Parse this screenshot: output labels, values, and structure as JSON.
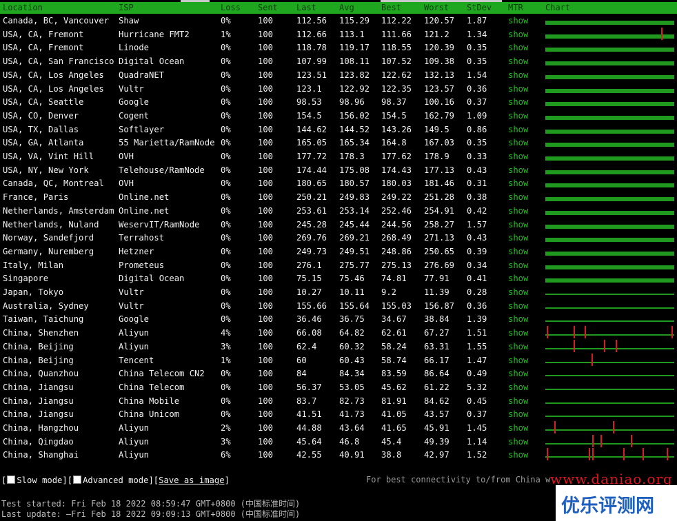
{
  "table": {
    "columns": [
      "Location",
      "ISP",
      "Loss",
      "Sent",
      "Last",
      "Avg",
      "Best",
      "Worst",
      "StDev",
      "MTR",
      "Chart"
    ],
    "rows": [
      {
        "location": "Canada, BC, Vancouver",
        "isp": "Shaw",
        "loss": "0%",
        "sent": "100",
        "last": "112.56",
        "avg": "115.29",
        "best": "112.22",
        "worst": "120.57",
        "stdev": "1.87",
        "mtr": "show"
      },
      {
        "location": "USA, CA, Fremont",
        "isp": "Hurricane FMT2",
        "loss": "1%",
        "sent": "100",
        "last": "112.66",
        "avg": "113.1",
        "best": "111.66",
        "worst": "121.2",
        "stdev": "1.34",
        "mtr": "show"
      },
      {
        "location": "USA, CA, Fremont",
        "isp": "Linode",
        "loss": "0%",
        "sent": "100",
        "last": "118.78",
        "avg": "119.17",
        "best": "118.55",
        "worst": "120.39",
        "stdev": "0.35",
        "mtr": "show"
      },
      {
        "location": "USA, CA, San Francisco",
        "isp": "Digital Ocean",
        "loss": "0%",
        "sent": "100",
        "last": "107.99",
        "avg": "108.11",
        "best": "107.52",
        "worst": "109.38",
        "stdev": "0.35",
        "mtr": "show"
      },
      {
        "location": "USA, CA, Los Angeles",
        "isp": "QuadraNET",
        "loss": "0%",
        "sent": "100",
        "last": "123.51",
        "avg": "123.82",
        "best": "122.62",
        "worst": "132.13",
        "stdev": "1.54",
        "mtr": "show"
      },
      {
        "location": "USA, CA, Los Angeles",
        "isp": "Vultr",
        "loss": "0%",
        "sent": "100",
        "last": "123.1",
        "avg": "122.92",
        "best": "122.35",
        "worst": "123.57",
        "stdev": "0.36",
        "mtr": "show"
      },
      {
        "location": "USA, CA, Seattle",
        "isp": "Google",
        "loss": "0%",
        "sent": "100",
        "last": "98.53",
        "avg": "98.96",
        "best": "98.37",
        "worst": "100.16",
        "stdev": "0.37",
        "mtr": "show"
      },
      {
        "location": "USA, CO, Denver",
        "isp": "Cogent",
        "loss": "0%",
        "sent": "100",
        "last": "154.5",
        "avg": "156.02",
        "best": "154.5",
        "worst": "162.79",
        "stdev": "1.09",
        "mtr": "show"
      },
      {
        "location": "USA, TX, Dallas",
        "isp": "Softlayer",
        "loss": "0%",
        "sent": "100",
        "last": "144.62",
        "avg": "144.52",
        "best": "143.26",
        "worst": "149.5",
        "stdev": "0.86",
        "mtr": "show"
      },
      {
        "location": "USA, GA, Atlanta",
        "isp": "55 Marietta/RamNode",
        "loss": "0%",
        "sent": "100",
        "last": "165.05",
        "avg": "165.34",
        "best": "164.8",
        "worst": "167.03",
        "stdev": "0.35",
        "mtr": "show"
      },
      {
        "location": "USA, VA, Vint Hill",
        "isp": "OVH",
        "loss": "0%",
        "sent": "100",
        "last": "177.72",
        "avg": "178.3",
        "best": "177.62",
        "worst": "178.9",
        "stdev": "0.33",
        "mtr": "show"
      },
      {
        "location": "USA, NY, New York",
        "isp": "Telehouse/RamNode",
        "loss": "0%",
        "sent": "100",
        "last": "174.44",
        "avg": "175.08",
        "best": "174.43",
        "worst": "177.13",
        "stdev": "0.43",
        "mtr": "show"
      },
      {
        "location": "Canada, QC, Montreal",
        "isp": "OVH",
        "loss": "0%",
        "sent": "100",
        "last": "180.65",
        "avg": "180.57",
        "best": "180.03",
        "worst": "181.46",
        "stdev": "0.31",
        "mtr": "show"
      },
      {
        "location": "France, Paris",
        "isp": "Online.net",
        "loss": "0%",
        "sent": "100",
        "last": "250.21",
        "avg": "249.83",
        "best": "249.22",
        "worst": "251.28",
        "stdev": "0.38",
        "mtr": "show"
      },
      {
        "location": "Netherlands, Amsterdam",
        "isp": "Online.net",
        "loss": "0%",
        "sent": "100",
        "last": "253.61",
        "avg": "253.14",
        "best": "252.46",
        "worst": "254.91",
        "stdev": "0.42",
        "mtr": "show"
      },
      {
        "location": "Netherlands, Nuland",
        "isp": "WeservIT/RamNode",
        "loss": "0%",
        "sent": "100",
        "last": "245.28",
        "avg": "245.44",
        "best": "244.56",
        "worst": "258.27",
        "stdev": "1.57",
        "mtr": "show"
      },
      {
        "location": "Norway, Sandefjord",
        "isp": "Terrahost",
        "loss": "0%",
        "sent": "100",
        "last": "269.76",
        "avg": "269.21",
        "best": "268.49",
        "worst": "271.13",
        "stdev": "0.43",
        "mtr": "show"
      },
      {
        "location": "Germany, Nuremberg",
        "isp": "Hetzner",
        "loss": "0%",
        "sent": "100",
        "last": "249.73",
        "avg": "249.51",
        "best": "248.86",
        "worst": "250.65",
        "stdev": "0.39",
        "mtr": "show"
      },
      {
        "location": "Italy, Milan",
        "isp": "Prometeus",
        "loss": "0%",
        "sent": "100",
        "last": "276.1",
        "avg": "275.77",
        "best": "275.13",
        "worst": "276.69",
        "stdev": "0.34",
        "mtr": "show"
      },
      {
        "location": "Singapore",
        "isp": "Digital Ocean",
        "loss": "0%",
        "sent": "100",
        "last": "75.15",
        "avg": "75.46",
        "best": "74.81",
        "worst": "77.91",
        "stdev": "0.41",
        "mtr": "show"
      },
      {
        "location": "Japan, Tokyo",
        "isp": "Vultr",
        "loss": "0%",
        "sent": "100",
        "last": "10.27",
        "avg": "10.11",
        "best": "9.2",
        "worst": "11.39",
        "stdev": "0.28",
        "mtr": "show"
      },
      {
        "location": "Australia, Sydney",
        "isp": "Vultr",
        "loss": "0%",
        "sent": "100",
        "last": "155.66",
        "avg": "155.64",
        "best": "155.03",
        "worst": "156.87",
        "stdev": "0.36",
        "mtr": "show"
      },
      {
        "location": "Taiwan, Taichung",
        "isp": "Google",
        "loss": "0%",
        "sent": "100",
        "last": "36.46",
        "avg": "36.75",
        "best": "34.67",
        "worst": "38.84",
        "stdev": "1.39",
        "mtr": "show"
      },
      {
        "location": "China, Shenzhen",
        "isp": "Aliyun",
        "loss": "4%",
        "sent": "100",
        "last": "66.08",
        "avg": "64.82",
        "best": "62.61",
        "worst": "67.27",
        "stdev": "1.51",
        "mtr": "show"
      },
      {
        "location": "China, Beijing",
        "isp": "Aliyun",
        "loss": "3%",
        "sent": "100",
        "last": "62.4",
        "avg": "60.32",
        "best": "58.24",
        "worst": "63.31",
        "stdev": "1.55",
        "mtr": "show"
      },
      {
        "location": "China, Beijing",
        "isp": "Tencent",
        "loss": "1%",
        "sent": "100",
        "last": "60",
        "avg": "60.43",
        "best": "58.74",
        "worst": "66.17",
        "stdev": "1.47",
        "mtr": "show"
      },
      {
        "location": "China, Quanzhou",
        "isp": "China Telecom CN2",
        "loss": "0%",
        "sent": "100",
        "last": "84",
        "avg": "84.34",
        "best": "83.59",
        "worst": "86.64",
        "stdev": "0.49",
        "mtr": "show"
      },
      {
        "location": "China, Jiangsu",
        "isp": "China Telecom",
        "loss": "0%",
        "sent": "100",
        "last": "56.37",
        "avg": "53.05",
        "best": "45.62",
        "worst": "61.22",
        "stdev": "5.32",
        "mtr": "show"
      },
      {
        "location": "China, Jiangsu",
        "isp": "China Mobile",
        "loss": "0%",
        "sent": "100",
        "last": "83.7",
        "avg": "82.73",
        "best": "81.91",
        "worst": "84.62",
        "stdev": "0.45",
        "mtr": "show"
      },
      {
        "location": "China, Jiangsu",
        "isp": "China Unicom",
        "loss": "0%",
        "sent": "100",
        "last": "41.51",
        "avg": "41.73",
        "best": "41.05",
        "worst": "43.57",
        "stdev": "0.37",
        "mtr": "show"
      },
      {
        "location": "China, Hangzhou",
        "isp": "Aliyun",
        "loss": "2%",
        "sent": "100",
        "last": "44.88",
        "avg": "43.64",
        "best": "41.65",
        "worst": "45.91",
        "stdev": "1.45",
        "mtr": "show"
      },
      {
        "location": "China, Qingdao",
        "isp": "Aliyun",
        "loss": "3%",
        "sent": "100",
        "last": "45.64",
        "avg": "46.8",
        "best": "45.4",
        "worst": "49.39",
        "stdev": "1.14",
        "mtr": "show"
      },
      {
        "location": "China, Shanghai",
        "isp": "Aliyun",
        "loss": "6%",
        "sent": "100",
        "last": "42.55",
        "avg": "40.91",
        "best": "38.8",
        "worst": "42.97",
        "stdev": "1.52",
        "mtr": "show"
      }
    ]
  },
  "controls": {
    "open_bracket": "[",
    "slow_mode_label": "Slow mode",
    "sep": "][",
    "advanced_mode_label": "Advanced mode",
    "sep2": "][",
    "save_label": "Save as image",
    "close_bracket": "]"
  },
  "note": "For best connectivity to/from China w",
  "status": {
    "test_started": "Test started: Fri Feb 18 2022 08:59:47 GMT+0800 (中国标准时间)",
    "last_update": "Last update: —Fri Feb 18 2022 09:09:13 GMT+0800 (中国标准时间)"
  },
  "watermark": {
    "url": "www.daniao.org",
    "text": "优乐评测网"
  },
  "colors": {
    "header_bg": "#1fa81f",
    "bar": "#1f9a1f",
    "spike": "#d42020",
    "mtr_link": "#20c020"
  },
  "chart_data": {
    "type": "bar",
    "xlabel": "",
    "ylabel": "",
    "series": [
      {
        "spikes": []
      },
      {
        "spikes": [
          0.91
        ]
      },
      {
        "spikes": []
      },
      {
        "spikes": []
      },
      {
        "spikes": []
      },
      {
        "spikes": []
      },
      {
        "spikes": []
      },
      {
        "spikes": []
      },
      {
        "spikes": []
      },
      {
        "spikes": []
      },
      {
        "spikes": []
      },
      {
        "spikes": []
      },
      {
        "spikes": []
      },
      {
        "spikes": []
      },
      {
        "spikes": []
      },
      {
        "spikes": []
      },
      {
        "spikes": []
      },
      {
        "spikes": []
      },
      {
        "spikes": []
      },
      {
        "spikes": []
      },
      {
        "spikes": [],
        "thin": true
      },
      {
        "spikes": [],
        "thin": true
      },
      {
        "spikes": [],
        "thin": true
      },
      {
        "spikes": [
          0.01,
          0.22,
          0.31,
          0.99
        ],
        "thin": true
      },
      {
        "spikes": [
          0.22,
          0.46,
          0.55
        ],
        "thin": true
      },
      {
        "spikes": [
          0.36
        ],
        "thin": true
      },
      {
        "spikes": [],
        "thin": true
      },
      {
        "spikes": [],
        "thin": true
      },
      {
        "spikes": [],
        "thin": true
      },
      {
        "spikes": [],
        "thin": true
      },
      {
        "spikes": [
          0.07,
          0.53
        ],
        "thin": true
      },
      {
        "spikes": [
          0.37,
          0.43,
          0.67
        ],
        "thin": true
      },
      {
        "spikes": [
          0.01,
          0.34,
          0.37,
          0.61,
          0.76,
          0.95
        ],
        "thin": true
      }
    ]
  }
}
